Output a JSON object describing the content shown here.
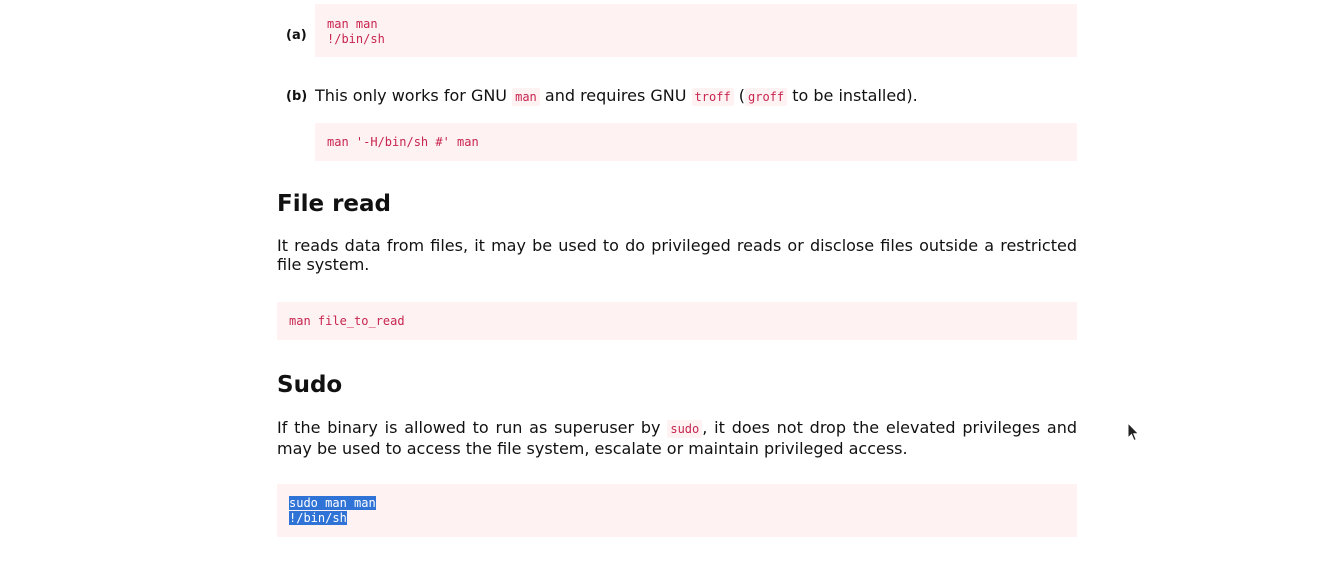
{
  "shell": {
    "list": [
      {
        "marker": "(a)",
        "code_lines": [
          "man man",
          "!/bin/sh"
        ]
      },
      {
        "marker": "(b)",
        "text_parts": {
          "t1": "This only works for GNU ",
          "c1": "man",
          "t2": " and requires GNU ",
          "c2": "troff",
          "t3": " (",
          "c3": "groff",
          "t4": " to be installed)."
        },
        "code": "man '-H/bin/sh #' man"
      }
    ]
  },
  "file_read": {
    "heading": "File read",
    "description": "It reads data from files, it may be used to do privileged reads or disclose files outside a restricted file system.",
    "code": "man file_to_read"
  },
  "sudo": {
    "heading": "Sudo",
    "description_parts": {
      "t1": "If the binary is allowed to run as superuser by ",
      "c1": "sudo",
      "t2": ", it does not drop the elevated privileges and may be used to access the file system, escalate or maintain privileged access."
    },
    "code_lines": [
      "sudo man man",
      "!/bin/sh"
    ]
  },
  "icons": {
    "cursor": "mouse-pointer-icon"
  }
}
